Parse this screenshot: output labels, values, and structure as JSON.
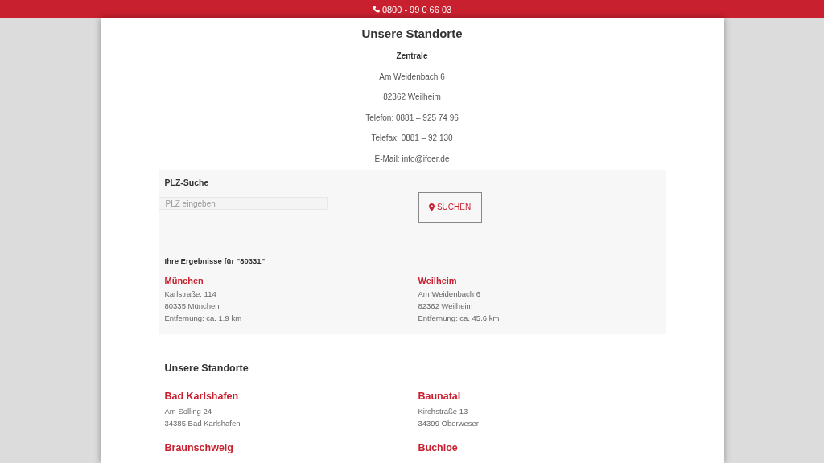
{
  "top_bar": {
    "phone": "0800 - 99 0 66 03"
  },
  "title": "Unsere Standorte",
  "headquarters": {
    "label": "Zentrale",
    "lines": [
      "Am Weidenbach 6",
      "82362 Weilheim",
      "Telefon: 0881 – 925 74 96",
      "Telefax: 0881 – 92 130",
      "E-Mail: info@ifoer.de"
    ]
  },
  "search": {
    "title": "PLZ-Suche",
    "placeholder": "PLZ eingeben",
    "button": "SUCHEN",
    "results_title": "Ihre Ergebnisse für \"80331\"",
    "results": [
      {
        "name": "München",
        "street": "Karlstraße. 114",
        "city": "80335 München",
        "distance": "Entfernung: ca. 1.9 km"
      },
      {
        "name": "Weilheim",
        "street": "Am Weidenbach 6",
        "city": "82362 Weilheim",
        "distance": "Entfernung: ca. 45.6 km"
      }
    ]
  },
  "locations": {
    "title": "Unsere Standorte",
    "items": [
      {
        "name": "Bad Karlshafen",
        "street": "Am Solling 24",
        "city": "34385 Bad Karlshafen"
      },
      {
        "name": "Baunatal",
        "street": "Kirchstraße 13",
        "city": "34399 Oberweser"
      },
      {
        "name": "Braunschweig"
      },
      {
        "name": "Buchloe"
      }
    ]
  }
}
